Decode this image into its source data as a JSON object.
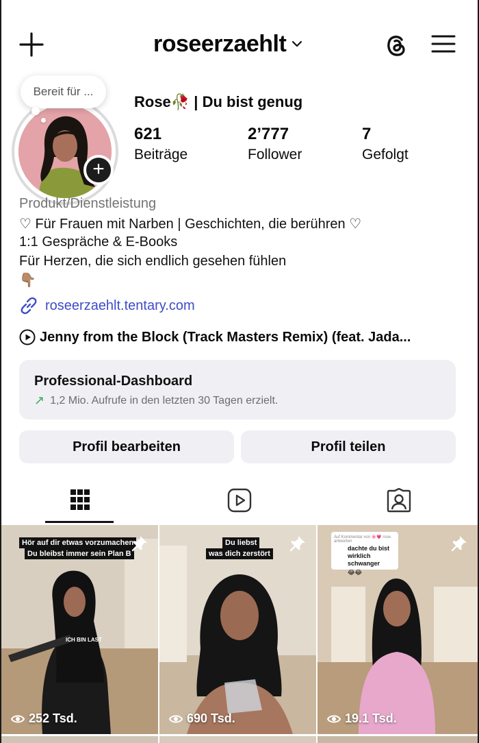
{
  "header": {
    "username": "roseerzaehlt"
  },
  "profile": {
    "note_placeholder": "Bereit für ...",
    "display_name": "Rose🥀 | Du bist genug",
    "stats": [
      {
        "value": "621",
        "label": "Beiträge"
      },
      {
        "value": "2’777",
        "label": "Follower"
      },
      {
        "value": "7",
        "label": "Gefolgt"
      }
    ],
    "category": "Produkt/Dienstleistung",
    "bio_lines": [
      "♡ Für Frauen mit Narben | Geschichten, die berühren ♡",
      "1:1 Gespräche & E-Books",
      "Für Herzen, die sich endlich gesehen fühlen",
      "👇🏽"
    ],
    "link": "roseerzaehlt.tentary.com",
    "music": "Jenny from the Block (Track Masters Remix) (feat. Jada..."
  },
  "dashboard": {
    "title": "Professional-Dashboard",
    "subtitle": "1,2 Mio. Aufrufe in den letzten 30 Tagen erzielt."
  },
  "actions": {
    "edit_profile": "Profil bearbeiten",
    "share_profile": "Profil teilen"
  },
  "tabs": {
    "active": "grid",
    "icons": [
      "grid-icon",
      "reels-icon",
      "tagged-icon"
    ]
  },
  "posts": [
    {
      "views": "252 Tsd.",
      "caption_lines": [
        "Hör auf dir etwas vorzumachen",
        "Du bleibst immer sein Plan B"
      ],
      "overlay_small": "ICH BIN LAST",
      "pinned": true
    },
    {
      "views": "690 Tsd.",
      "caption_lines": [
        "Du liebst",
        "was dich zerstört"
      ],
      "pinned": true
    },
    {
      "views": "19.1 Tsd.",
      "comment_header": "Auf Kommentar von 🌸💗 rose antworten",
      "comment_text": "dachte du bist wirklich schwanger",
      "comment_emoji": "😂😂",
      "pinned": true
    }
  ],
  "colors": {
    "link": "#3e4cc7",
    "button_bg": "#efeff4",
    "growth_arrow": "#3ca65a"
  }
}
